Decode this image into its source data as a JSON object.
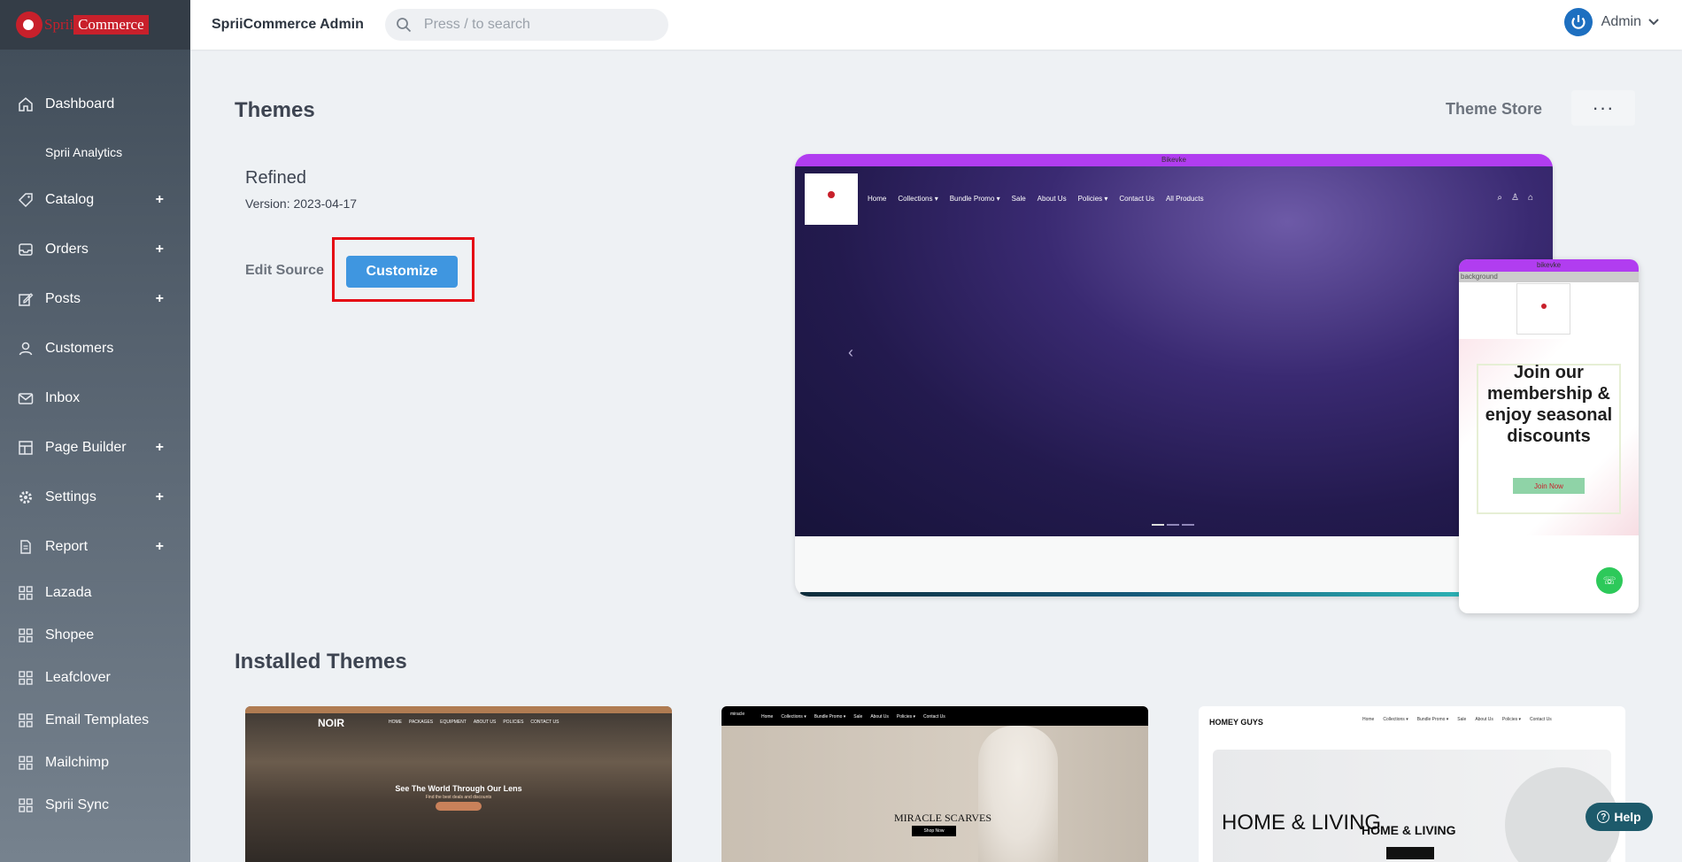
{
  "brand": {
    "logo_part1": "Sprii",
    "logo_part2": "Commerce",
    "accent": "#c8202b"
  },
  "header": {
    "app_title": "SpriiCommerce Admin",
    "search_placeholder": "Press / to search",
    "user_name": "Admin"
  },
  "sidebar": {
    "items": [
      {
        "label": "Dashboard",
        "icon": "home-icon",
        "expandable": false
      },
      {
        "label": "Sprii Analytics",
        "icon": "",
        "expandable": false
      },
      {
        "label": "Catalog",
        "icon": "tag-icon",
        "expandable": true
      },
      {
        "label": "Orders",
        "icon": "inbox-tray-icon",
        "expandable": true
      },
      {
        "label": "Posts",
        "icon": "edit-icon",
        "expandable": true
      },
      {
        "label": "Customers",
        "icon": "user-icon",
        "expandable": false
      },
      {
        "label": "Inbox",
        "icon": "mail-icon",
        "expandable": false
      },
      {
        "label": "Page Builder",
        "icon": "layout-icon",
        "expandable": true
      },
      {
        "label": "Settings",
        "icon": "gear-icon",
        "expandable": true
      },
      {
        "label": "Report",
        "icon": "file-icon",
        "expandable": true
      },
      {
        "label": "Lazada",
        "icon": "grid-icon",
        "expandable": false
      },
      {
        "label": "Shopee",
        "icon": "grid-icon",
        "expandable": false
      },
      {
        "label": "Leafclover",
        "icon": "grid-icon",
        "expandable": false
      },
      {
        "label": "Email Templates",
        "icon": "grid-icon",
        "expandable": false
      },
      {
        "label": "Mailchimp",
        "icon": "grid-icon",
        "expandable": false
      },
      {
        "label": "Sprii Sync",
        "icon": "grid-icon",
        "expandable": false
      }
    ],
    "plus_glyph": "+"
  },
  "main": {
    "title": "Themes",
    "theme_store_label": "Theme Store",
    "more_label": "···",
    "current_theme": {
      "name": "Refined",
      "version": "Version: 2023-04-17",
      "edit_source_label": "Edit Source",
      "customize_label": "Customize"
    },
    "installed_title": "Installed Themes"
  },
  "desktop_preview": {
    "topbar_text": "Bikevke",
    "nav": [
      "Home",
      "Collections ▾",
      "Bundle Promo ▾",
      "Sale",
      "About Us",
      "Policies ▾",
      "Contact Us",
      "All Products"
    ],
    "icons": [
      "⌕",
      "♙",
      "⌂"
    ],
    "prev_arrow": "‹"
  },
  "mobile_preview": {
    "topbar_text": "bikevke",
    "strip_text": "background",
    "promo_text": "Join our membership & enjoy seasonal discounts",
    "join_label": "Join Now",
    "wa_glyph": "☏"
  },
  "installed": [
    {
      "logo": "NOIR",
      "nav": [
        "HOME",
        "PACKAGES",
        "EQUIPMENT",
        "ABOUT US",
        "POLICIES",
        "CONTACT US"
      ],
      "headline": "See The World Through Our Lens",
      "subline": "Find the best deals and discounts"
    },
    {
      "logo": "miracle",
      "nav": [
        "Home",
        "Collections ▾",
        "Bundle Promo ▾",
        "Sale",
        "About Us",
        "Policies ▾",
        "Contact Us"
      ],
      "headline": "MIRACLE SCARVES",
      "button": "Shop Now"
    },
    {
      "logo": "HOMEY GUYS",
      "nav": [
        "Home",
        "Collections ▾",
        "Bundle Promo ▾",
        "Sale",
        "About Us",
        "Policies ▾",
        "Contact Us"
      ],
      "headline_left": "HOME & LIVING",
      "headline_center": "HOME & LIVING"
    }
  ],
  "help": {
    "label": "Help",
    "glyph": "?"
  }
}
